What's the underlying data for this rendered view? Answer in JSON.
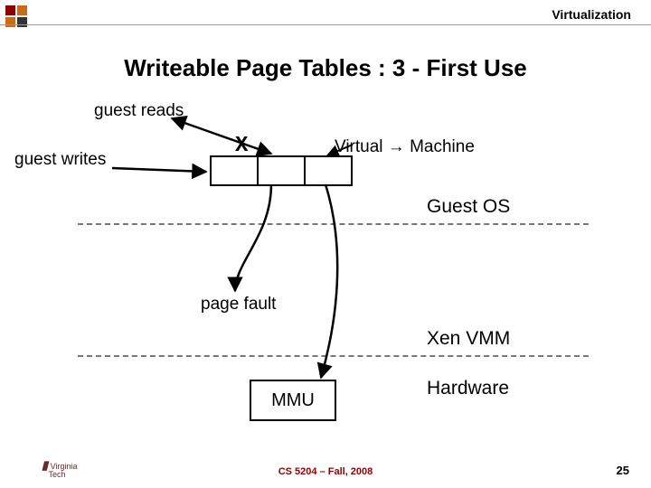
{
  "header": {
    "topic": "Virtualization"
  },
  "title": "Writeable Page Tables : 3 - First Use",
  "labels": {
    "guest_reads": "guest reads",
    "guest_writes": "guest writes",
    "virtual_machine": "Virtual → Machine",
    "guest_os": "Guest OS",
    "page_fault": "page fault",
    "xen_vmm": "Xen VMM",
    "hardware": "Hardware",
    "x": "X",
    "mmu": "MMU"
  },
  "footer": {
    "course": "CS 5204 – Fall, 2008",
    "page": "25",
    "uni": "Virginia",
    "dept": "Tech"
  },
  "colors": {
    "maroon": "#900000",
    "orange": "#cc6a1a",
    "dark": "#333"
  }
}
